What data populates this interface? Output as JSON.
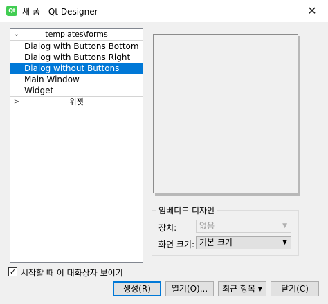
{
  "window": {
    "app_icon_text": "Qt",
    "title": "새 폼 - Qt Designer",
    "close_symbol": "✕"
  },
  "tree": {
    "categories": [
      {
        "label": "templates\\forms",
        "expanded_symbol": "⌄",
        "items": [
          "Dialog with Buttons Bottom",
          "Dialog with Buttons Right",
          "Dialog without Buttons",
          "Main Window",
          "Widget"
        ],
        "selected_index": 2
      },
      {
        "label": "위젯",
        "collapsed_symbol": ">"
      }
    ]
  },
  "embedded_design": {
    "title": "임베디드 디자인",
    "device_label": "장치:",
    "device_value": "없음",
    "screen_size_label": "화면 크기:",
    "screen_size_value": "기본 크기"
  },
  "show_on_startup": {
    "checked": true,
    "check_mark": "✓",
    "label": "시작할 때 이 대화상자 보이기"
  },
  "buttons": {
    "create": "생성(R)",
    "open": "열기(O)...",
    "recent": "최근 항목",
    "recent_caret": "▾",
    "close": "닫기(C)"
  }
}
